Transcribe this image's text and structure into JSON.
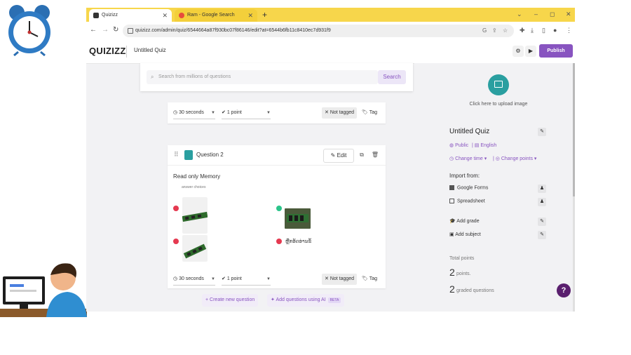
{
  "browser": {
    "tabs": [
      {
        "label": "Quizizz",
        "icon": "quizizz-favicon",
        "active": true
      },
      {
        "label": "Ram - Google Search",
        "icon": "google-favicon",
        "active": false
      }
    ],
    "new_tab": "+",
    "url": "quizizz.com/admin/quiz/6544664a87f930bc07f86146/edit?at=6544b6fb11c8410ec7d931f9",
    "window_controls": {
      "chevron": "⌄",
      "minimize": "–",
      "restore": "◻",
      "close": "✕"
    }
  },
  "app": {
    "logo": "QUIZIZZ",
    "quiz_title": "Untitled Quiz",
    "publish_label": "Publish",
    "accent_color": "#8854c0"
  },
  "search": {
    "placeholder": "Search from millions of questions",
    "button": "Search"
  },
  "question_controls": {
    "time": "30 seconds",
    "points": "1 point",
    "not_tagged": "Not tagged",
    "tag": "Tag"
  },
  "question": {
    "label": "Question 2",
    "edit": "Edit",
    "text": "Read only Memory",
    "answer_choices_label": "answer choices",
    "option_text": "ຫຼືກອັດອ່ານຂໍ້"
  },
  "actions": {
    "create_new": "Create new question",
    "add_ai": "Add questions using AI",
    "beta": "BETA"
  },
  "panel": {
    "upload_text": "Click here to upload image",
    "title": "Untitled Quiz",
    "visibility": "Public",
    "language": "English",
    "change_time": "Change time",
    "change_points": "Change points",
    "import_from": "Import from:",
    "google_forms": "Google Forms",
    "spreadsheet": "Spreadsheet",
    "add_grade": "Add grade",
    "add_subject": "Add subject",
    "total_points_label": "Total points",
    "points_value": "2",
    "points_suffix": "points.",
    "graded_value": "2",
    "graded_suffix": "graded questions",
    "help": "?"
  }
}
